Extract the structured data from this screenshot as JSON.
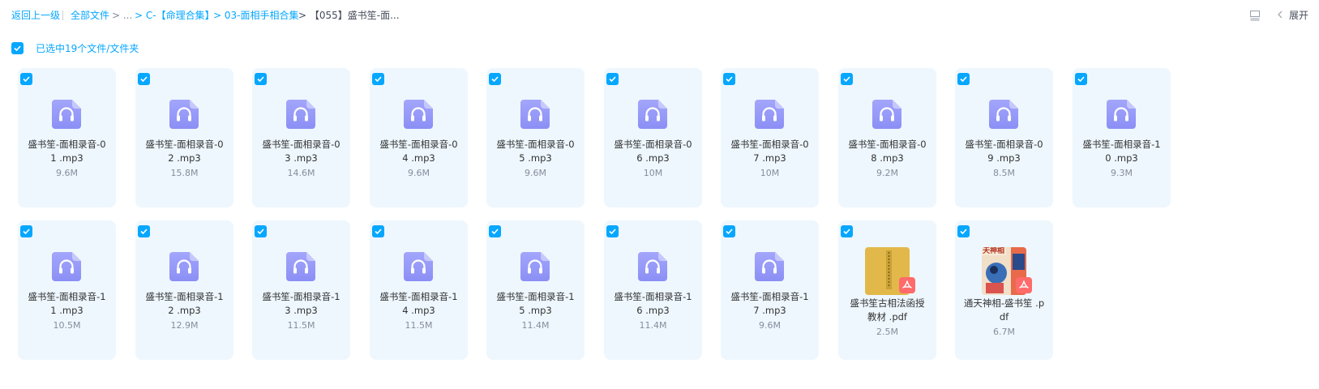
{
  "breadcrumb": {
    "back": "返回上一级",
    "all_files": "全部文件",
    "ellipsis": "> ...",
    "items": [
      "> C-【命理合集】",
      "> 03-面相手相合集"
    ],
    "current": "> 【055】盛书笙-面..."
  },
  "toolbar": {
    "expand_label": "展开",
    "icons": [
      "list-view-icon",
      "chevron-left-icon"
    ]
  },
  "selection": {
    "text": "已选中19个文件/文件夹",
    "checked": true
  },
  "colors": {
    "accent": "#06a7ff",
    "card_bg": "#eef7fe",
    "audio_icon": "#8b8ff5",
    "pdf_badge": "#ff6a6a"
  },
  "files": [
    {
      "line1": "盛书笙-面相录音-0",
      "line2": "1 .mp3",
      "size": "9.6M",
      "type": "audio",
      "checked": true
    },
    {
      "line1": "盛书笙-面相录音-0",
      "line2": "2 .mp3",
      "size": "15.8M",
      "type": "audio",
      "checked": true
    },
    {
      "line1": "盛书笙-面相录音-0",
      "line2": "3 .mp3",
      "size": "14.6M",
      "type": "audio",
      "checked": true
    },
    {
      "line1": "盛书笙-面相录音-0",
      "line2": "4 .mp3",
      "size": "9.6M",
      "type": "audio",
      "checked": true
    },
    {
      "line1": "盛书笙-面相录音-0",
      "line2": "5 .mp3",
      "size": "9.6M",
      "type": "audio",
      "checked": true
    },
    {
      "line1": "盛书笙-面相录音-0",
      "line2": "6 .mp3",
      "size": "10M",
      "type": "audio",
      "checked": true
    },
    {
      "line1": "盛书笙-面相录音-0",
      "line2": "7 .mp3",
      "size": "10M",
      "type": "audio",
      "checked": true
    },
    {
      "line1": "盛书笙-面相录音-0",
      "line2": "8 .mp3",
      "size": "9.2M",
      "type": "audio",
      "checked": true
    },
    {
      "line1": "盛书笙-面相录音-0",
      "line2": "9 .mp3",
      "size": "8.5M",
      "type": "audio",
      "checked": true
    },
    {
      "line1": "盛书笙-面相录音-1",
      "line2": "0 .mp3",
      "size": "9.3M",
      "type": "audio",
      "checked": true
    },
    {
      "line1": "盛书笙-面相录音-1",
      "line2": "1 .mp3",
      "size": "10.5M",
      "type": "audio",
      "checked": true
    },
    {
      "line1": "盛书笙-面相录音-1",
      "line2": "2 .mp3",
      "size": "12.9M",
      "type": "audio",
      "checked": true
    },
    {
      "line1": "盛书笙-面相录音-1",
      "line2": "3 .mp3",
      "size": "11.5M",
      "type": "audio",
      "checked": true
    },
    {
      "line1": "盛书笙-面相录音-1",
      "line2": "4 .mp3",
      "size": "11.5M",
      "type": "audio",
      "checked": true
    },
    {
      "line1": "盛书笙-面相录音-1",
      "line2": "5 .mp3",
      "size": "11.4M",
      "type": "audio",
      "checked": true
    },
    {
      "line1": "盛书笙-面相录音-1",
      "line2": "6 .mp3",
      "size": "11.4M",
      "type": "audio",
      "checked": true
    },
    {
      "line1": "盛书笙-面相录音-1",
      "line2": "7 .mp3",
      "size": "9.6M",
      "type": "audio",
      "checked": true
    },
    {
      "line1": "盛书笙古相法函授",
      "line2": "教材 .pdf",
      "size": "2.5M",
      "type": "pdf",
      "thumb": "yellow-book-cover",
      "checked": true
    },
    {
      "line1": "通天神相-盛书笙 .p",
      "line2": "df",
      "size": "6.7M",
      "type": "pdf",
      "thumb": "illustrated-book-cover",
      "thumb_text": "天神相",
      "checked": true
    }
  ]
}
